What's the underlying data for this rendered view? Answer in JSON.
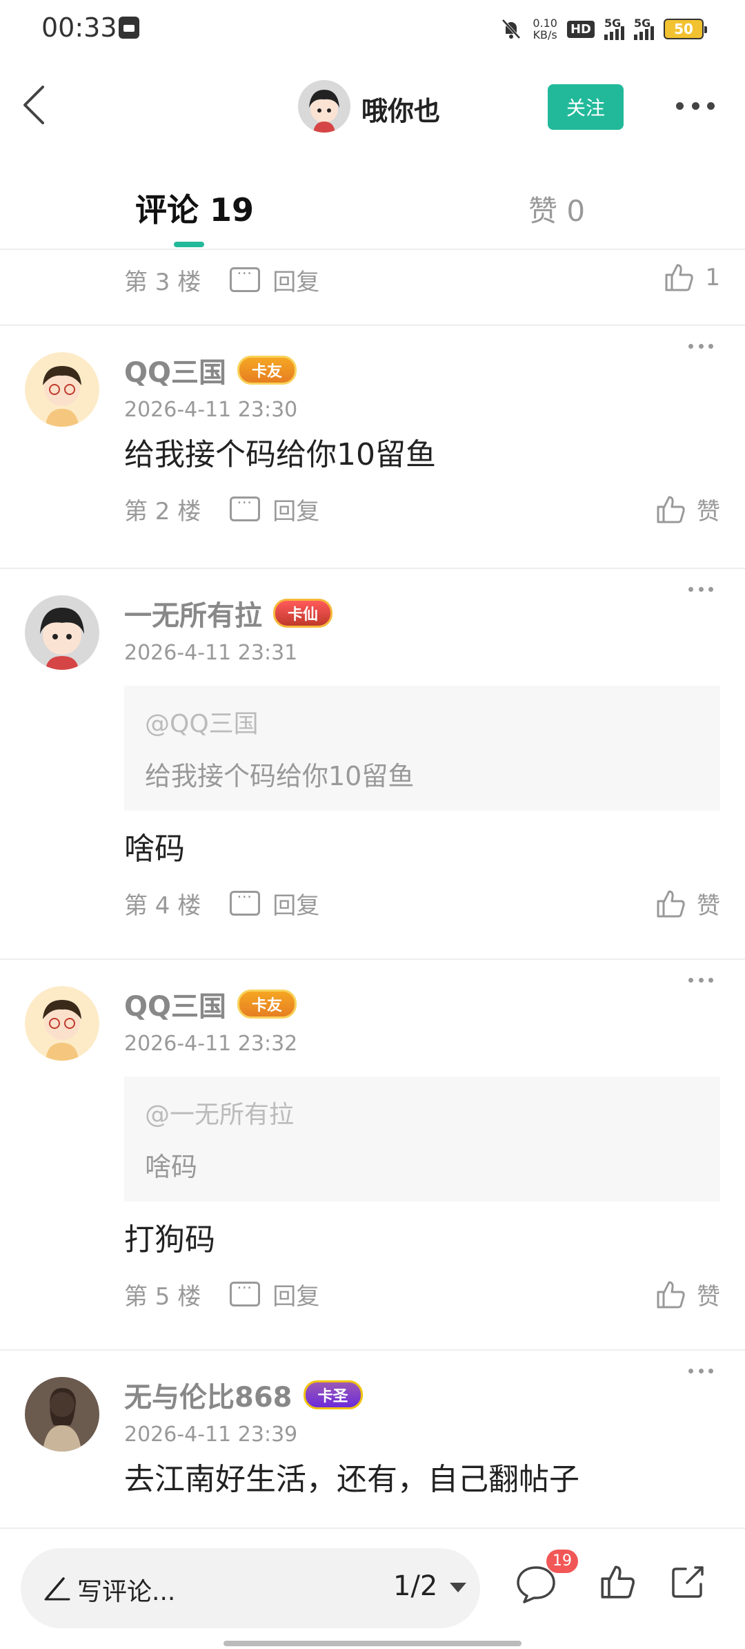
{
  "status_bar": {
    "time": "00:33",
    "net_speed_value": "0.10",
    "net_speed_unit": "KB/s",
    "hd_label": "HD",
    "sim1_label": "5G",
    "sim2_label": "5G",
    "battery": "50"
  },
  "header": {
    "name": "哦你也",
    "follow_label": "关注"
  },
  "tabs": {
    "comments_label": "评论 19",
    "likes_label": "赞 0"
  },
  "top_partial": {
    "floor": "第 3 楼",
    "reply_label": "回复",
    "like_label": "1"
  },
  "comments": [
    {
      "name": "QQ三国",
      "badge": "卡友",
      "time": "2026-4-11 23:30",
      "text": "给我接个码给你10留鱼",
      "floor": "第 2 楼",
      "reply_label": "回复",
      "like_label": "赞"
    },
    {
      "name": "一无所有拉",
      "badge": "卡仙",
      "time": "2026-4-11 23:31",
      "quote_user": "@QQ三国",
      "quote_text": "给我接个码给你10留鱼",
      "text": "啥码",
      "floor": "第 4 楼",
      "reply_label": "回复",
      "like_label": "赞"
    },
    {
      "name": "QQ三国",
      "badge": "卡友",
      "time": "2026-4-11 23:32",
      "quote_user": "@一无所有拉",
      "quote_text": "啥码",
      "text": "打狗码",
      "floor": "第 5 楼",
      "reply_label": "回复",
      "like_label": "赞"
    },
    {
      "name": "无与伦比868",
      "badge": "卡圣",
      "time": "2026-4-11 23:39",
      "text": "去江南好生活，还有，自己翻帖子"
    }
  ],
  "bottom_bar": {
    "write_label": "写评论...",
    "page_indicator": "1/2",
    "comment_count": "19"
  },
  "colors": {
    "accent": "#22b99a",
    "badge_red": "#f25757"
  }
}
